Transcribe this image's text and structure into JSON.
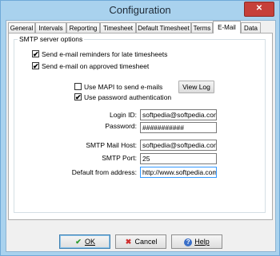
{
  "window": {
    "title": "Configuration",
    "close_glyph": "✕"
  },
  "tabs": [
    {
      "label": "General"
    },
    {
      "label": "Intervals"
    },
    {
      "label": "Reporting"
    },
    {
      "label": "Timesheet"
    },
    {
      "label": "Default Timesheet"
    },
    {
      "label": "Terms"
    },
    {
      "label": "E-Mail"
    },
    {
      "label": "Data"
    }
  ],
  "active_tab": "E-Mail",
  "smtp": {
    "group_label": "SMTP server options",
    "send_late": {
      "label": "Send e-mail reminders for late timesheets",
      "checked": true
    },
    "send_approved": {
      "label": "Send e-mail on approved timesheet",
      "checked": true
    },
    "use_mapi": {
      "label": "Use MAPI to send e-mails",
      "checked": false
    },
    "use_password_auth": {
      "label": "Use password authentication",
      "checked": true
    },
    "view_log_label": "View Log",
    "login_id_label": "Login ID:",
    "login_id_value": "softpedia@softpedia.com",
    "password_label": "Password:",
    "password_value": "###########",
    "mail_host_label": "SMTP Mail Host:",
    "mail_host_value": "softpedia@softpedia.com",
    "port_label": "SMTP Port:",
    "port_value": "25",
    "default_from_label": "Default from address:",
    "default_from_value": "http://www.softpedia.com/"
  },
  "buttons": {
    "ok": {
      "label": "OK",
      "icon": "check-icon"
    },
    "cancel": {
      "label": "Cancel",
      "icon": "x-icon"
    },
    "help": {
      "label": "Help",
      "icon": "help-icon"
    }
  }
}
